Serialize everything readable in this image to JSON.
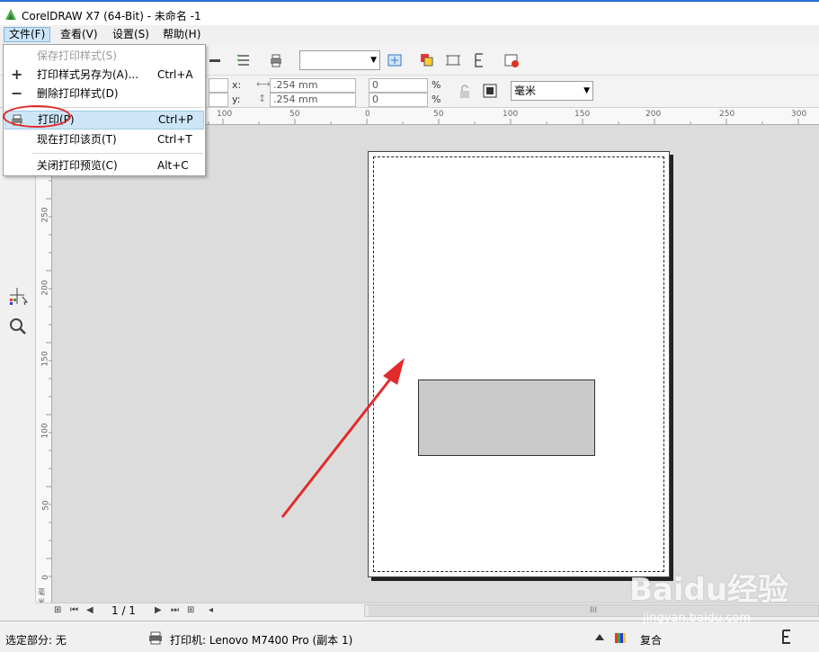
{
  "window": {
    "title": "CorelDRAW X7 (64-Bit) - 未命名 -1"
  },
  "menubar": {
    "items": [
      {
        "label": "文件(F)"
      },
      {
        "label": "查看(V)"
      },
      {
        "label": "设置(S)"
      },
      {
        "label": "帮助(H)"
      }
    ]
  },
  "file_menu": {
    "items": [
      {
        "label": "保存打印样式(S)",
        "shortcut": "",
        "disabled": true
      },
      {
        "label": "打印样式另存为(A)...",
        "shortcut": "Ctrl+A"
      },
      {
        "label": "删除打印样式(D)",
        "shortcut": ""
      },
      {
        "label": "打印(P)",
        "shortcut": "Ctrl+P",
        "highlighted": true
      },
      {
        "label": "现在打印该页(T)",
        "shortcut": "Ctrl+T"
      },
      {
        "label": "关闭打印预览(C)",
        "shortcut": "Alt+C"
      }
    ]
  },
  "property_bar": {
    "x_label": "x:",
    "y_label": "y:",
    "x_value": ".254 mm",
    "y_value": ".254 mm",
    "scale_x": "0",
    "scale_y": "0",
    "percent": "%",
    "units": "毫米"
  },
  "rulers": {
    "top_ticks": [
      "100",
      "50",
      "0",
      "50",
      "100",
      "150",
      "200",
      "250",
      "300"
    ],
    "left_ticks": [
      "250",
      "200",
      "150",
      "100",
      "50",
      "0"
    ],
    "left_unit": "毫米"
  },
  "page_nav": {
    "page_indicator": "1 / 1",
    "scroll_grip": "III"
  },
  "status": {
    "selection": "选定部分: 无",
    "printer": "打印机: Lenovo M7400 Pro (副本 1)",
    "mode": "复合"
  },
  "watermark": {
    "brand": "Baidu经验",
    "url": "jingyan.baidu.com"
  },
  "colors": {
    "accent": "#2a6fd6",
    "highlight": "#cde6f7",
    "annotation": "#e22b2b",
    "shape_fill": "#c9cac9"
  }
}
